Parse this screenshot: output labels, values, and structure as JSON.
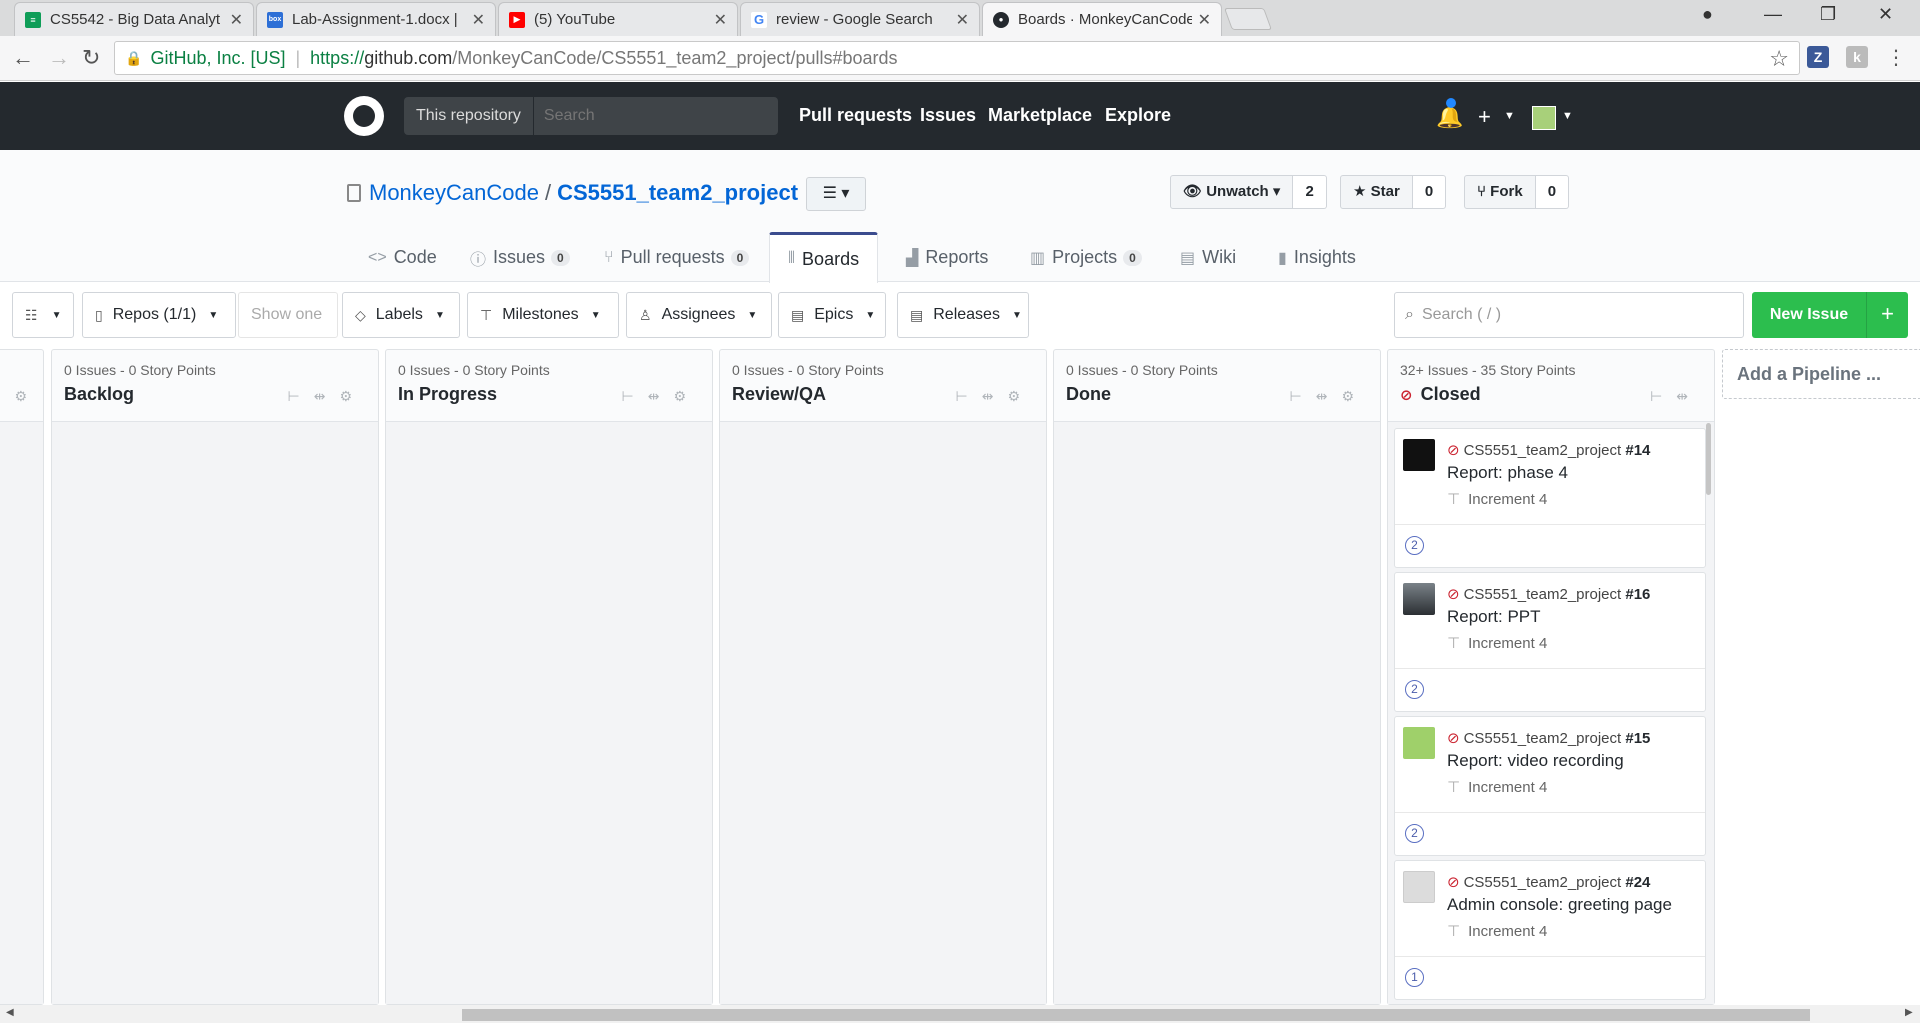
{
  "browser": {
    "tabs": [
      {
        "title": "CS5542 - Big Data Analyt",
        "fav_color": "#0f9d58",
        "fav": "≡"
      },
      {
        "title": "Lab-Assignment-1.docx |",
        "fav_color": "#2d6fd6",
        "fav": "box"
      },
      {
        "title": "(5) YouTube",
        "fav_color": "#ff0000",
        "fav": "▶"
      },
      {
        "title": "review - Google Search",
        "fav_color": "#ffffff",
        "fav": "G"
      },
      {
        "title": "Boards · MonkeyCanCode",
        "fav_color": "#24292e",
        "fav": "●"
      }
    ],
    "secure_label": "GitHub, Inc. [US]",
    "url_scheme": "https://",
    "url_host": "github.com",
    "url_path": "/MonkeyCanCode/CS5551_team2_project/pulls#boards"
  },
  "github_header": {
    "scope_label": "This repository",
    "search_placeholder": "Search",
    "nav": [
      "Pull requests",
      "Issues",
      "Marketplace",
      "Explore"
    ]
  },
  "repo": {
    "owner": "MonkeyCanCode",
    "name": "CS5551_team2_project",
    "watch_label": "Unwatch",
    "watch_count": "2",
    "star_label": "Star",
    "star_count": "0",
    "fork_label": "Fork",
    "fork_count": "0",
    "tabs": [
      {
        "label": "Code",
        "icon": "<>"
      },
      {
        "label": "Issues",
        "icon": "ⓘ",
        "count": "0"
      },
      {
        "label": "Pull requests",
        "icon": "⑂",
        "count": "0"
      },
      {
        "label": "Boards",
        "icon": "⦀"
      },
      {
        "label": "Reports",
        "icon": "▟"
      },
      {
        "label": "Projects",
        "icon": "▥",
        "count": "0"
      },
      {
        "label": "Wiki",
        "icon": "▤"
      },
      {
        "label": "Insights",
        "icon": "▮"
      }
    ]
  },
  "toolbar": {
    "repos": "Repos (1/1)",
    "show_one": "Show one",
    "labels": "Labels",
    "milestones": "Milestones",
    "assignees": "Assignees",
    "epics": "Epics",
    "releases": "Releases",
    "search_placeholder": "Search ( / )",
    "new_issue": "New Issue"
  },
  "pipelines": [
    {
      "meta": "0 Issues - 0 Story Points",
      "name": "Backlog"
    },
    {
      "meta": "0 Issues - 0 Story Points",
      "name": "In Progress"
    },
    {
      "meta": "0 Issues - 0 Story Points",
      "name": "Review/QA"
    },
    {
      "meta": "0 Issues - 0 Story Points",
      "name": "Done"
    },
    {
      "meta": "32+ Issues - 35 Story Points",
      "name": "Closed"
    }
  ],
  "add_pipeline": "Add a Pipeline ...",
  "cards": [
    {
      "repo": "CS5551_team2_project",
      "num": "#14",
      "title": "Report: phase 4",
      "milestone": "Increment 4",
      "estimate": "2",
      "avatar_color": "#111111"
    },
    {
      "repo": "CS5551_team2_project",
      "num": "#16",
      "title": "Report: PPT",
      "milestone": "Increment 4",
      "estimate": "2",
      "avatar_color": "#3a3f44"
    },
    {
      "repo": "CS5551_team2_project",
      "num": "#15",
      "title": "Report: video recording",
      "milestone": "Increment 4",
      "estimate": "2",
      "avatar_color": "#9fd06a"
    },
    {
      "repo": "CS5551_team2_project",
      "num": "#24",
      "title": "Admin console: greeting page",
      "milestone": "Increment 4",
      "estimate": "1",
      "avatar_color": "#dcdcdc"
    }
  ]
}
